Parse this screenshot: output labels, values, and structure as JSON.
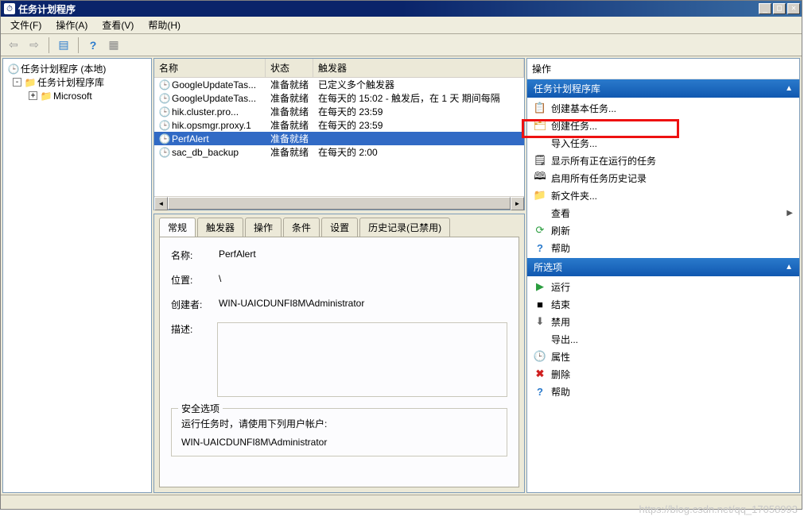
{
  "window": {
    "title": "任务计划程序"
  },
  "menu": {
    "file": "文件(F)",
    "action": "操作(A)",
    "view": "查看(V)",
    "help": "帮助(H)"
  },
  "tree": {
    "root": "任务计划程序 (本地)",
    "lib": "任务计划程序库",
    "ms": "Microsoft"
  },
  "list": {
    "cols": {
      "name": "名称",
      "state": "状态",
      "trigger": "触发器"
    },
    "rows": [
      {
        "name": "GoogleUpdateTas...",
        "state": "准备就绪",
        "trigger": "已定义多个触发器",
        "sel": false
      },
      {
        "name": "GoogleUpdateTas...",
        "state": "准备就绪",
        "trigger": "在每天的 15:02 - 触发后，在 1 天 期间每隔",
        "sel": false
      },
      {
        "name": "hik.cluster.pro...",
        "state": "准备就绪",
        "trigger": "在每天的 23:59",
        "sel": false
      },
      {
        "name": "hik.opsmgr.proxy.1",
        "state": "准备就绪",
        "trigger": "在每天的 23:59",
        "sel": false
      },
      {
        "name": "PerfAlert",
        "state": "准备就绪",
        "trigger": "",
        "sel": true
      },
      {
        "name": "sac_db_backup",
        "state": "准备就绪",
        "trigger": "在每天的 2:00",
        "sel": false
      }
    ]
  },
  "tabs": {
    "general": "常规",
    "triggers": "触发器",
    "actions": "操作",
    "conditions": "条件",
    "settings": "设置",
    "history": "历史记录(已禁用)"
  },
  "detail": {
    "name_lbl": "名称:",
    "name_val": "PerfAlert",
    "loc_lbl": "位置:",
    "loc_val": "\\",
    "creator_lbl": "创建者:",
    "creator_val": "WIN-UAICDUNFI8M\\Administrator",
    "desc_lbl": "描述:",
    "sec_legend": "安全选项",
    "sec_runas": "运行任务时，请使用下列用户帐户:",
    "sec_user": "WIN-UAICDUNFI8M\\Administrator"
  },
  "actions": {
    "panel_title": "操作",
    "sec1": "任务计划程序库",
    "create_basic": "创建基本任务...",
    "create_task": "创建任务...",
    "import": "导入任务...",
    "show_running": "显示所有正在运行的任务",
    "enable_history": "启用所有任务历史记录",
    "new_folder": "新文件夹...",
    "view": "查看",
    "refresh": "刷新",
    "help": "帮助",
    "sec2": "所选项",
    "run": "运行",
    "end": "结束",
    "disable": "禁用",
    "export": "导出...",
    "props": "属性",
    "delete": "删除",
    "help2": "帮助"
  },
  "watermark": "https://blog.csdn.net/qq_17058993"
}
